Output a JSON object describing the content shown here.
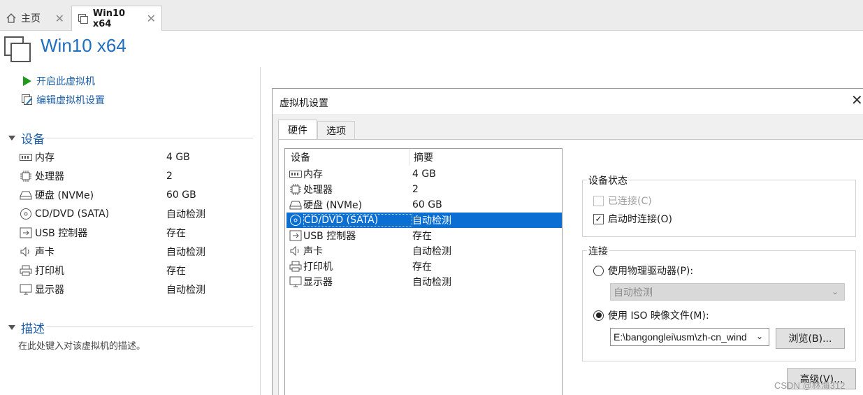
{
  "tabs": [
    {
      "label": "主页",
      "icon": "home-icon",
      "close": "✕"
    },
    {
      "label": "Win10 x64",
      "icon": "vm-icon",
      "close": "✕"
    }
  ],
  "vm": {
    "title": "Win10 x64"
  },
  "commands": {
    "power_on": "开启此虚拟机",
    "edit_settings": "编辑虚拟机设置"
  },
  "devices_section": {
    "title": "设备",
    "items": [
      {
        "name": "内存",
        "value": "4 GB",
        "icon": "memory-icon"
      },
      {
        "name": "处理器",
        "value": "2",
        "icon": "cpu-icon"
      },
      {
        "name": "硬盘 (NVMe)",
        "value": "60 GB",
        "icon": "harddisk-icon"
      },
      {
        "name": "CD/DVD (SATA)",
        "value": "自动检测",
        "icon": "cd-icon"
      },
      {
        "name": "USB 控制器",
        "value": "存在",
        "icon": "usb-icon"
      },
      {
        "name": "声卡",
        "value": "自动检测",
        "icon": "speaker-icon"
      },
      {
        "name": "打印机",
        "value": "存在",
        "icon": "printer-icon"
      },
      {
        "name": "显示器",
        "value": "自动检测",
        "icon": "monitor-icon"
      }
    ]
  },
  "description_section": {
    "title": "描述",
    "text": "在此处键入对该虚拟机的描述。"
  },
  "dialog": {
    "title": "虚拟机设置",
    "close": "✕",
    "tabs": [
      "硬件",
      "选项"
    ],
    "list": {
      "headers": [
        "设备",
        "摘要"
      ],
      "selected_index": 3,
      "rows": [
        {
          "name": "内存",
          "summary": "4 GB",
          "icon": "memory-icon"
        },
        {
          "name": "处理器",
          "summary": "2",
          "icon": "cpu-icon"
        },
        {
          "name": "硬盘 (NVMe)",
          "summary": "60 GB",
          "icon": "harddisk-icon"
        },
        {
          "name": "CD/DVD (SATA)",
          "summary": "自动检测",
          "icon": "cd-icon"
        },
        {
          "name": "USB 控制器",
          "summary": "存在",
          "icon": "usb-icon"
        },
        {
          "name": "声卡",
          "summary": "自动检测",
          "icon": "speaker-icon"
        },
        {
          "name": "打印机",
          "summary": "存在",
          "icon": "printer-icon"
        },
        {
          "name": "显示器",
          "summary": "自动检测",
          "icon": "monitor-icon"
        }
      ]
    },
    "device_status": {
      "label": "设备状态",
      "connected": {
        "label": "已连接(C)",
        "checked": false,
        "disabled": true
      },
      "connect_at_power_on": {
        "label": "启动时连接(O)",
        "checked": true,
        "disabled": false
      }
    },
    "connection": {
      "label": "连接",
      "physical": {
        "label": "使用物理驱动器(P):",
        "selected": false,
        "value": "自动检测"
      },
      "iso": {
        "label": "使用 ISO 映像文件(M):",
        "selected": true,
        "value": "E:\\bangonglei\\usm\\zh-cn_wind"
      },
      "browse": "浏览(B)...",
      "advanced": "高级(V)..."
    }
  },
  "watermark": "CSDN @林海312",
  "colors": {
    "accent": "#1e6fbf",
    "selection": "#0b6ed3",
    "play_green": "#1f9a1f"
  }
}
